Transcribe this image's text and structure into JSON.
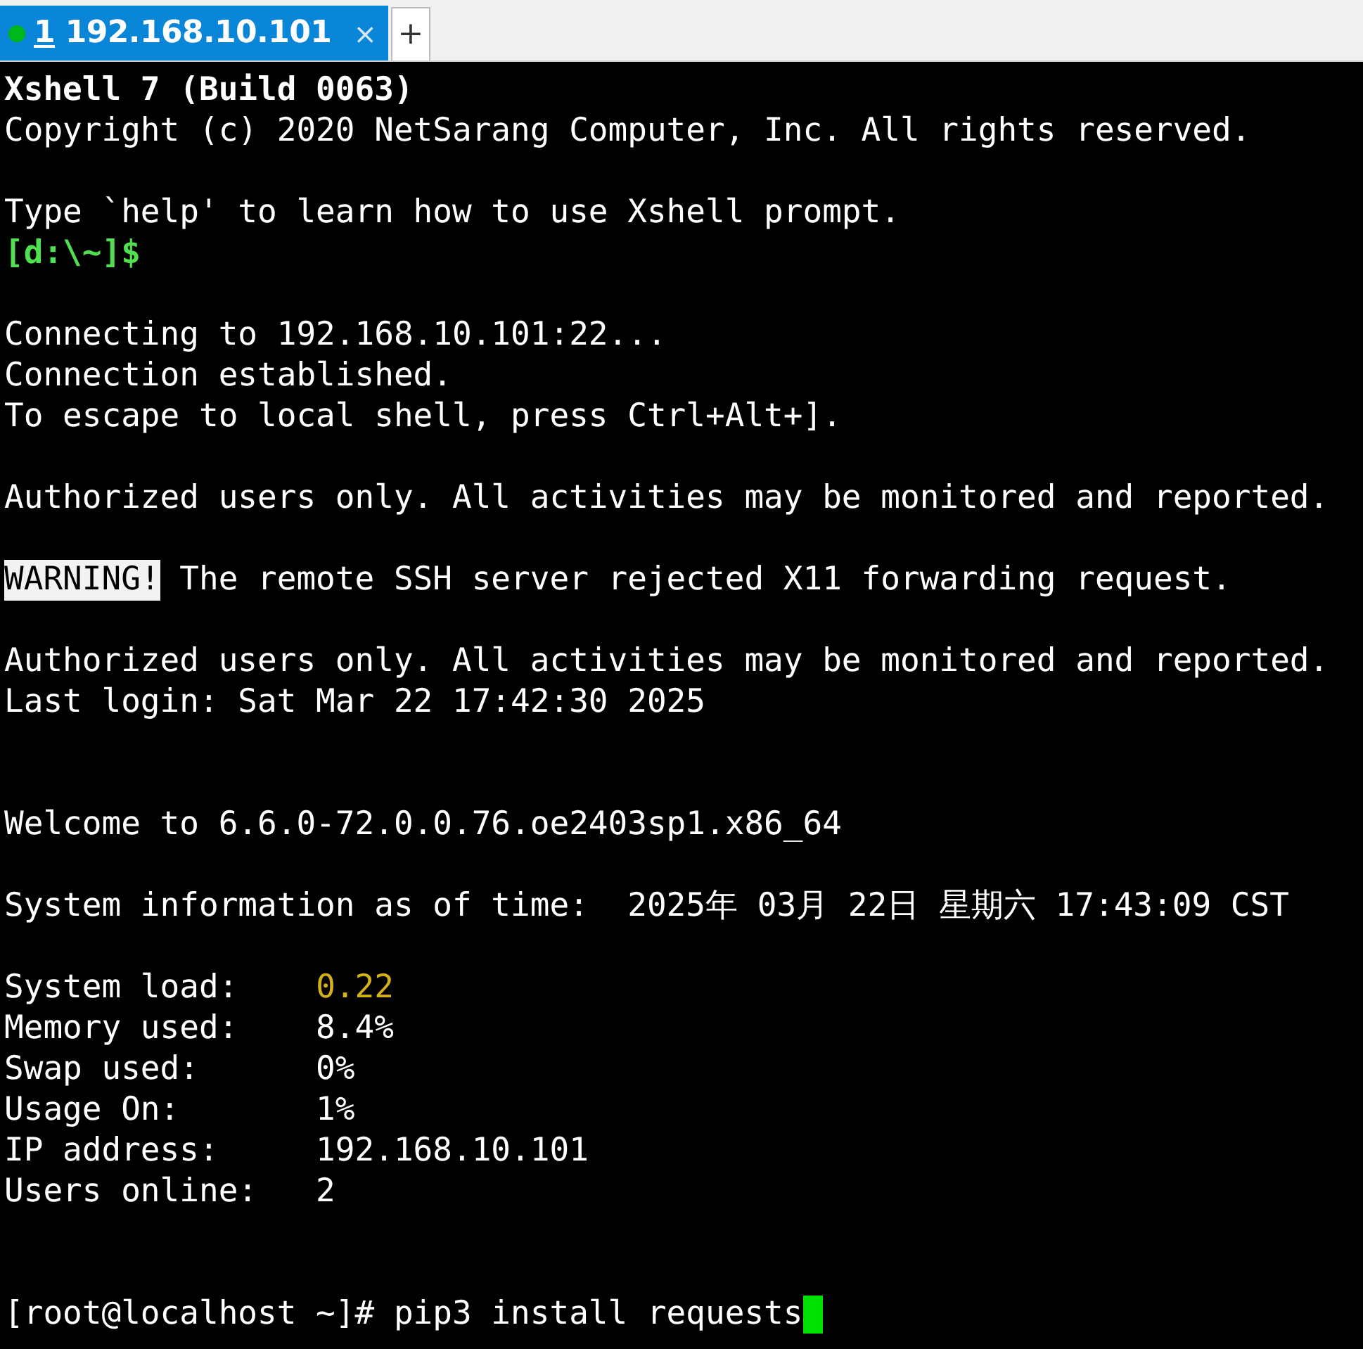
{
  "tabs": [
    {
      "number": "1",
      "label": "192.168.10.101",
      "connected": true,
      "selected": true,
      "close": "×"
    }
  ],
  "new_tab": "+",
  "terminal": {
    "lines": [
      {
        "kind": "text",
        "parts": [
          {
            "text": "Xshell 7 (Build 0063)",
            "kind": "bold"
          }
        ]
      },
      {
        "kind": "text",
        "parts": [
          {
            "text": "Copyright (c) 2020 NetSarang Computer, Inc. All rights reserved.",
            "kind": "normal"
          }
        ]
      },
      {
        "kind": "blank"
      },
      {
        "kind": "text",
        "parts": [
          {
            "text": "Type `help' to learn how to use Xshell prompt.",
            "kind": "normal"
          }
        ]
      },
      {
        "kind": "text",
        "parts": [
          {
            "text": "[d:\\~]$",
            "kind": "prompt"
          }
        ]
      },
      {
        "kind": "blank"
      },
      {
        "kind": "text",
        "parts": [
          {
            "text": "Connecting to 192.168.10.101:22...",
            "kind": "normal"
          }
        ]
      },
      {
        "kind": "text",
        "parts": [
          {
            "text": "Connection established.",
            "kind": "normal"
          }
        ]
      },
      {
        "kind": "text",
        "parts": [
          {
            "text": "To escape to local shell, press Ctrl+Alt+].",
            "kind": "normal"
          }
        ]
      },
      {
        "kind": "blank"
      },
      {
        "kind": "text",
        "parts": [
          {
            "text": "Authorized users only. All activities may be monitored and reported.",
            "kind": "normal"
          }
        ]
      },
      {
        "kind": "blank"
      },
      {
        "kind": "text",
        "parts": [
          {
            "text": "WARNING!",
            "kind": "highlight"
          },
          {
            "text": " The remote SSH server rejected X11 forwarding request.",
            "kind": "normal"
          }
        ]
      },
      {
        "kind": "blank"
      },
      {
        "kind": "text",
        "parts": [
          {
            "text": "Authorized users only. All activities may be monitored and reported.",
            "kind": "normal"
          }
        ]
      },
      {
        "kind": "text",
        "parts": [
          {
            "text": "Last login: Sat Mar 22 17:42:30 2025",
            "kind": "normal"
          }
        ]
      },
      {
        "kind": "blank"
      },
      {
        "kind": "blank"
      },
      {
        "kind": "text",
        "parts": [
          {
            "text": "Welcome to 6.6.0-72.0.0.76.oe2403sp1.x86_64",
            "kind": "normal"
          }
        ]
      },
      {
        "kind": "blank"
      },
      {
        "kind": "text",
        "parts": [
          {
            "text": "System information as of time:  2025年 03月 22日 星期六 17:43:09 CST",
            "kind": "normal"
          }
        ]
      },
      {
        "kind": "blank"
      },
      {
        "kind": "text",
        "parts": [
          {
            "text": "System load:    ",
            "kind": "normal"
          },
          {
            "text": "0.22",
            "kind": "warning"
          }
        ]
      },
      {
        "kind": "text",
        "parts": [
          {
            "text": "Memory used:    8.4%",
            "kind": "normal"
          }
        ]
      },
      {
        "kind": "text",
        "parts": [
          {
            "text": "Swap used:      0%",
            "kind": "normal"
          }
        ]
      },
      {
        "kind": "text",
        "parts": [
          {
            "text": "Usage On:       1%",
            "kind": "normal"
          }
        ]
      },
      {
        "kind": "text",
        "parts": [
          {
            "text": "IP address:     192.168.10.101",
            "kind": "normal"
          }
        ]
      },
      {
        "kind": "text",
        "parts": [
          {
            "text": "Users online:   2",
            "kind": "normal"
          }
        ]
      },
      {
        "kind": "blank"
      },
      {
        "kind": "blank"
      },
      {
        "kind": "text",
        "parts": [
          {
            "text": "[root@localhost ~]# pip3 install requests",
            "kind": "normal"
          }
        ],
        "cursor": true
      }
    ]
  }
}
